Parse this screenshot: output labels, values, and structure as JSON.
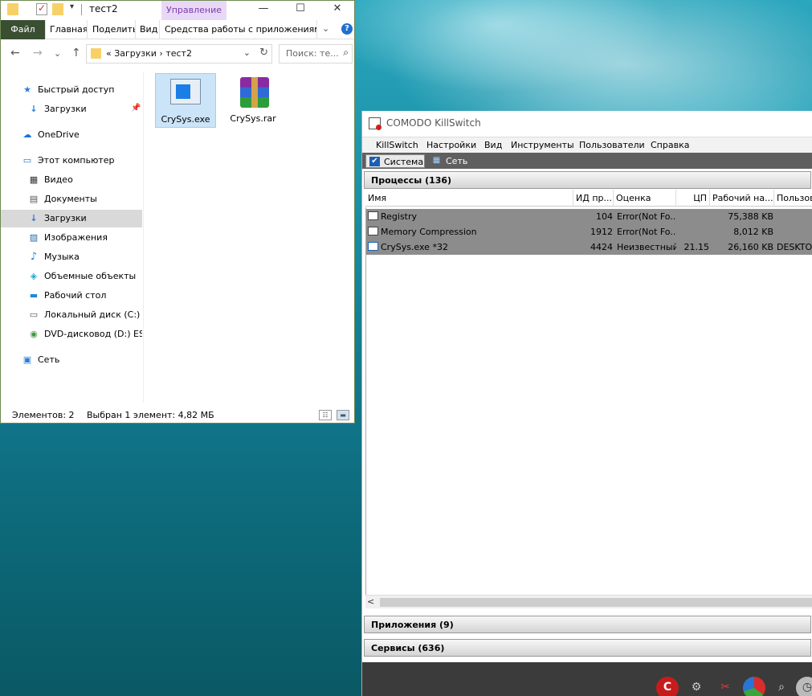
{
  "explorer": {
    "title": "тест2",
    "context_tab": "Управление",
    "window_buttons": {
      "minimize": "—",
      "maximize": "☐",
      "close": "✕"
    },
    "ribbon": {
      "tabs": [
        "Файл",
        "Главная",
        "Поделиться",
        "Вид",
        "Средства работы с приложениями"
      ],
      "collapse": "⌄",
      "help": "?"
    },
    "nav": {
      "back": "←",
      "forward": "→",
      "recent": "⌄",
      "up": "↑"
    },
    "address": {
      "path": "«  Загрузки  ›  тест2",
      "dropdown": "⌄",
      "refresh": "↻"
    },
    "search": {
      "placeholder": "Поиск: те...",
      "icon": "⌕"
    },
    "navpane": [
      {
        "label": "Быстрый доступ",
        "icon": "★"
      },
      {
        "label": "Загрузки",
        "icon": "↓"
      },
      {
        "label": "OneDrive",
        "icon": "☁"
      },
      {
        "label": "Этот компьютер",
        "icon": "▭"
      },
      {
        "label": "Видео",
        "icon": "▦"
      },
      {
        "label": "Документы",
        "icon": "▤"
      },
      {
        "label": "Загрузки",
        "icon": "↓"
      },
      {
        "label": "Изображения",
        "icon": "▨"
      },
      {
        "label": "Музыка",
        "icon": "♪"
      },
      {
        "label": "Объемные объекты",
        "icon": "◈"
      },
      {
        "label": "Рабочий стол",
        "icon": "▬"
      },
      {
        "label": "Локальный диск (C:)",
        "icon": "▭"
      },
      {
        "label": "DVD-дисковод (D:) ESD",
        "icon": "◉"
      },
      {
        "label": "Сеть",
        "icon": "▣"
      }
    ],
    "files": [
      {
        "name": "CrySys.exe"
      },
      {
        "name": "CrySys.rar"
      }
    ],
    "status": {
      "count": "Элементов: 2",
      "selected": "Выбран 1 элемент: 4,82 МБ"
    },
    "colors": {
      "accent": "#3a4e32",
      "selection": "#cce4f7",
      "context": "#e9d8f5"
    }
  },
  "killswitch": {
    "title": "COMODO KillSwitch",
    "menu": [
      "KillSwitch",
      "Настройки",
      "Вид",
      "Инструменты",
      "Пользователи",
      "Справка"
    ],
    "tabs": [
      {
        "label": "Система",
        "icon": "✔"
      },
      {
        "label": "Сеть",
        "icon": "▦"
      }
    ],
    "processes_header": "Процессы (136)",
    "columns": [
      "Имя",
      "ИД пр...",
      "Оценка",
      "ЦП",
      "Рабочий на...",
      "Пользов"
    ],
    "rows": [
      {
        "name": "Registry",
        "pid": "104",
        "rating": "Error(Not Fo...",
        "cpu": "",
        "ws": "75,388 KB",
        "user": ""
      },
      {
        "name": "Memory Compression",
        "pid": "1912",
        "rating": "Error(Not Fo...",
        "cpu": "",
        "ws": "8,012 KB",
        "user": ""
      },
      {
        "name": "CrySys.exe *32",
        "pid": "4424",
        "rating": "Неизвестный",
        "cpu": "21.15",
        "ws": "26,160 KB",
        "user": "DESKTOP"
      }
    ],
    "scroll_left": "<",
    "apps_header": "Приложения (9)",
    "services_header": "Сервисы (636)",
    "tray_icons": [
      "comodo-c-icon",
      "gear-icon",
      "tools-icon",
      "chart-icon",
      "magnifier-icon",
      "clock-icon"
    ]
  }
}
